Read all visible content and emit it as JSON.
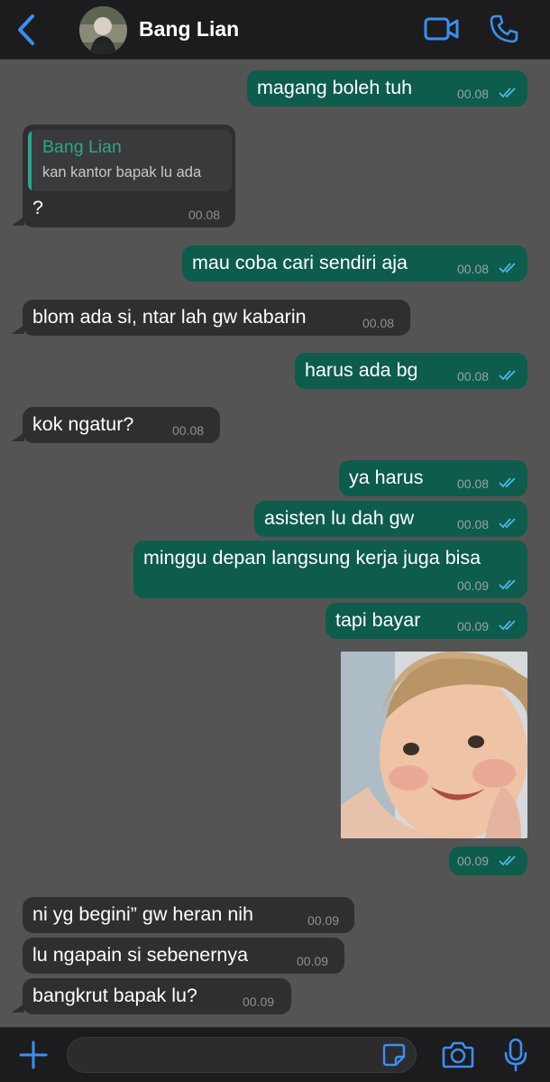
{
  "header": {
    "contact_name": "Bang Lian",
    "back_icon": "chevron-left-icon",
    "video_icon": "video-camera-icon",
    "call_icon": "phone-icon"
  },
  "messages": [
    {
      "dir": "out",
      "text": "magang boleh tuh",
      "time": "00.08"
    },
    {
      "dir": "in",
      "reply_name": "Bang Lian",
      "reply_text": "kan kantor bapak lu ada",
      "text": "?",
      "time": "00.08"
    },
    {
      "dir": "out",
      "text": "mau coba cari sendiri aja",
      "time": "00.08"
    },
    {
      "dir": "in",
      "text": "blom ada si, ntar lah gw kabarin",
      "time": "00.08"
    },
    {
      "dir": "out",
      "text": "harus ada bg",
      "time": "00.08"
    },
    {
      "dir": "in",
      "text": "kok ngatur?",
      "time": "00.08"
    },
    {
      "dir": "out",
      "text": "ya harus",
      "time": "00.08"
    },
    {
      "dir": "out",
      "text": "asisten lu dah gw",
      "time": "00.08"
    },
    {
      "dir": "out",
      "text": "minggu depan langsung kerja juga bisa",
      "time": "00.09"
    },
    {
      "dir": "out",
      "text": "tapi bayar",
      "time": "00.09"
    },
    {
      "dir": "out",
      "type": "image",
      "time": "00.09"
    },
    {
      "dir": "in",
      "text": "ni yg begini” gw heran nih",
      "time": "00.09"
    },
    {
      "dir": "in",
      "text": "lu ngapain si sebenernya",
      "time": "00.09"
    },
    {
      "dir": "in",
      "text": "bangkrut bapak lu?",
      "time": "00.09"
    }
  ],
  "input_bar": {
    "placeholder": "",
    "plus_icon": "plus-icon",
    "sticker_icon": "sticker-icon",
    "camera_icon": "camera-icon",
    "mic_icon": "microphone-icon"
  },
  "colors": {
    "accent": "#3d8ef0",
    "outgoing_bubble": "#0d5c4c",
    "incoming_bubble": "#2f2f31",
    "chat_background": "#545454",
    "read_ticks": "#4fb6ec"
  }
}
